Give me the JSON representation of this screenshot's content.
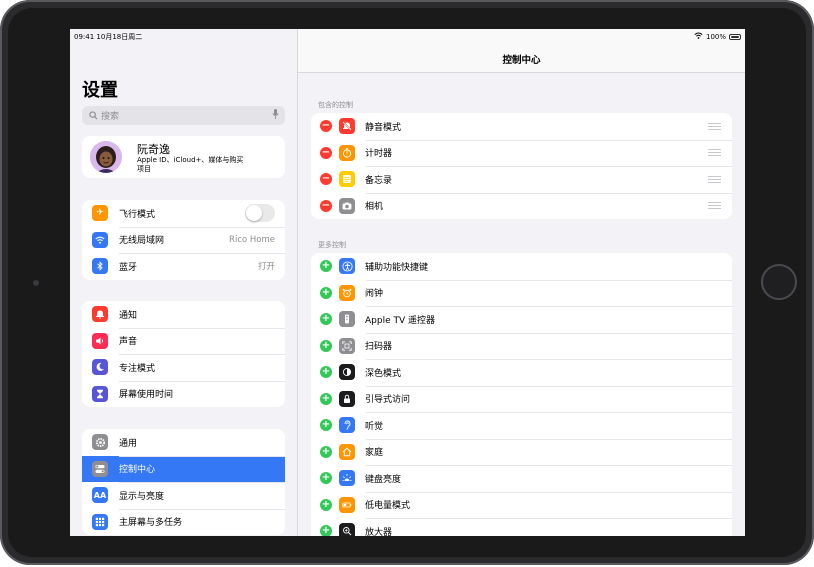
{
  "status": {
    "time": "09:41",
    "date": "10月18日周二",
    "battery": "100%"
  },
  "sidebar": {
    "title": "设置",
    "search_placeholder": "搜索",
    "profile": {
      "name": "阮奇逸",
      "subtitle": "Apple ID、iCloud+、媒体与购买项目"
    },
    "group1": [
      {
        "label": "飞行模式",
        "icon": "airplane-icon",
        "color": "#ff9500"
      },
      {
        "label": "无线局域网",
        "value": "Rico Home",
        "icon": "wifi-icon",
        "color": "#3478f6"
      },
      {
        "label": "蓝牙",
        "value": "打开",
        "icon": "bluetooth-icon",
        "color": "#3478f6"
      }
    ],
    "group2": [
      {
        "label": "通知",
        "icon": "notifications-icon",
        "color": "#ff3b30"
      },
      {
        "label": "声音",
        "icon": "speaker-icon",
        "color": "#ff2d55"
      },
      {
        "label": "专注模式",
        "icon": "moon-icon",
        "color": "#5856d6"
      },
      {
        "label": "屏幕使用时间",
        "icon": "hourglass-icon",
        "color": "#5856d6"
      }
    ],
    "group3": [
      {
        "label": "通用",
        "icon": "gear-icon",
        "color": "#8e8e93"
      },
      {
        "label": "控制中心",
        "icon": "switches-icon",
        "color": "#8e8e93",
        "selected": true
      },
      {
        "label": "显示与亮度",
        "icon": "text-size-icon",
        "color": "#3478f6"
      },
      {
        "label": "主屏幕与多任务",
        "icon": "grid-icon",
        "color": "#3478f6"
      }
    ]
  },
  "main": {
    "title": "控制中心",
    "included_title": "包含的控制",
    "included": [
      {
        "label": "静音模式",
        "icon": "bell-slash-icon",
        "color": "#ff3b30"
      },
      {
        "label": "计时器",
        "icon": "timer-icon",
        "color": "#ff9500"
      },
      {
        "label": "备忘录",
        "icon": "notes-icon",
        "color": "#ffcc00"
      },
      {
        "label": "相机",
        "icon": "camera-icon",
        "color": "#8e8e93"
      }
    ],
    "more_title": "更多控制",
    "more": [
      {
        "label": "辅助功能快捷键",
        "icon": "accessibility-icon",
        "color": "#3478f6"
      },
      {
        "label": "闹钟",
        "icon": "alarm-icon",
        "color": "#ff9500"
      },
      {
        "label": "Apple TV 遥控器",
        "icon": "remote-icon",
        "color": "#8e8e93"
      },
      {
        "label": "扫码器",
        "icon": "qr-code-icon",
        "color": "#8e8e93"
      },
      {
        "label": "深色模式",
        "icon": "dark-mode-icon",
        "color": "#1c1c1e"
      },
      {
        "label": "引导式访问",
        "icon": "lock-icon",
        "color": "#1c1c1e"
      },
      {
        "label": "听觉",
        "icon": "ear-icon",
        "color": "#3478f6"
      },
      {
        "label": "家庭",
        "icon": "home-icon",
        "color": "#ff9500"
      },
      {
        "label": "键盘亮度",
        "icon": "keyboard-brightness-icon",
        "color": "#3478f6"
      },
      {
        "label": "低电量模式",
        "icon": "battery-icon",
        "color": "#ff9500"
      },
      {
        "label": "放大器",
        "icon": "magnifier-icon",
        "color": "#1c1c1e"
      }
    ]
  }
}
